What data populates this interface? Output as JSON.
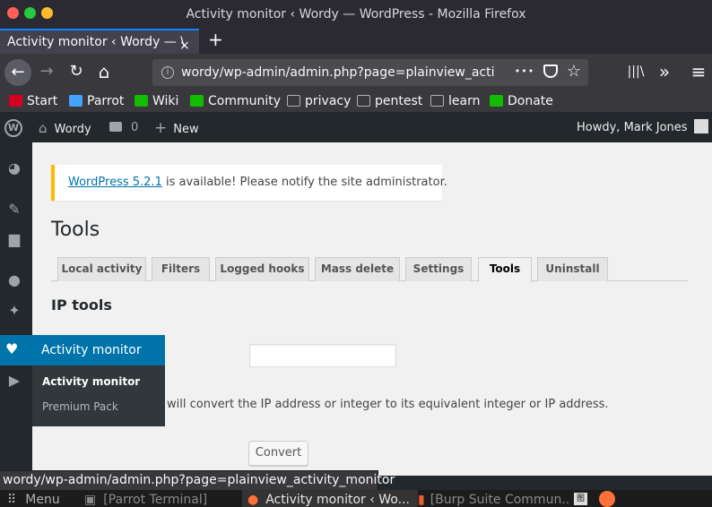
{
  "window": {
    "title": "Activity monitor ‹ Wordy — WordPress - Mozilla Firefox",
    "colors": {
      "close": "#ff5f57",
      "minimize": "#28c840",
      "maximize": "#febc2e"
    }
  },
  "browser": {
    "tab_title": "Activity monitor ‹ Wordy — \\",
    "tab_close": "×",
    "new_tab": "+",
    "url": "wordy/wp-admin/admin.php?page=plainview_activ",
    "url_info_icon": "i",
    "icons": {
      "back": "←",
      "forward": "→",
      "reload": "↻",
      "home": "⌂",
      "more": "•••",
      "pocket": "pocket-icon",
      "bookmark": "☆",
      "library": "|||\\",
      "overflow": "»",
      "menu": "≡"
    },
    "bookmarks": [
      {
        "label": "Start",
        "icon": "bookmark-icon",
        "color": "#d70022"
      },
      {
        "label": "Parrot",
        "icon": "parrot-icon",
        "color": "#45a1ff"
      },
      {
        "label": "Wiki",
        "icon": "wiki-icon",
        "color": "#12bc00"
      },
      {
        "label": "Community",
        "icon": "community-icon",
        "color": "#12bc00"
      },
      {
        "label": "privacy",
        "icon": "folder-icon",
        "color": "#b1b1b3"
      },
      {
        "label": "pentest",
        "icon": "folder-icon",
        "color": "#b1b1b3"
      },
      {
        "label": "learn",
        "icon": "folder-icon",
        "color": "#b1b1b3"
      },
      {
        "label": "Donate",
        "icon": "donate-icon",
        "color": "#12bc00"
      }
    ],
    "status_url": "wordy/wp-admin/admin.php?page=plainview_activity_monitor"
  },
  "wp_bar": {
    "site_name": "Wordy",
    "comments_count": "0",
    "new_label": "New",
    "greeting": "Howdy, Mark Jones"
  },
  "flyout": {
    "header": "Activity monitor",
    "items": [
      "Activity monitor",
      "Premium Pack"
    ]
  },
  "notice": {
    "link_text": "WordPress 5.2.1",
    "text": " is available! Please notify the site administrator."
  },
  "page": {
    "title": "Tools",
    "tabs": [
      {
        "label": "Local activity",
        "active": false
      },
      {
        "label": "Filters",
        "active": false
      },
      {
        "label": "Logged hooks",
        "active": false
      },
      {
        "label": "Mass delete",
        "active": false
      },
      {
        "label": "Settings",
        "active": false
      },
      {
        "label": "Tools",
        "active": true
      },
      {
        "label": "Uninstall",
        "active": false
      }
    ],
    "section_title": "IP tools",
    "ip_input_value": "",
    "description": "will convert the IP address or integer to its equivalent integer or IP address.",
    "convert_button": "Convert"
  },
  "taskbar": {
    "menu": "Menu",
    "items": [
      "[Parrot Terminal]",
      "Activity monitor ‹ Wo...",
      "[Burp Suite Commun..."
    ]
  }
}
